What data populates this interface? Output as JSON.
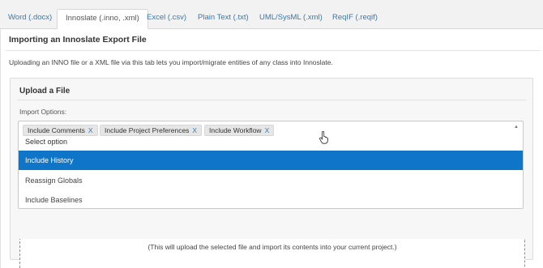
{
  "tabs": [
    {
      "label": "Word (.docx)",
      "active": false
    },
    {
      "label": "Innoslate (.inno, .xml)",
      "active": true
    },
    {
      "label": "Excel (.csv)",
      "active": false
    },
    {
      "label": "Plain Text (.txt)",
      "active": false
    },
    {
      "label": "UML/SysML (.xml)",
      "active": false
    },
    {
      "label": "ReqIF (.reqif)",
      "active": false
    }
  ],
  "section": {
    "title": "Importing an Innoslate Export File",
    "description": "Uploading an INNO file or a XML file via this tab lets you import/migrate entities of any class into Innoslate."
  },
  "upload": {
    "title": "Upload a File",
    "options_label": "Import Options:",
    "selected_options": [
      "Include Comments",
      "Include Project Preferences",
      "Include Workflow"
    ],
    "remove_glyph": "X",
    "select_placeholder": "Select option",
    "dropdown_items": [
      "Include History",
      "Reassign Globals",
      "Include Baselines"
    ],
    "highlighted_item": "Include History",
    "drop_note": "(This will upload the selected file and import its contents into your current project.)"
  },
  "colors": {
    "link": "#337ab7",
    "highlight": "#0e75c9"
  },
  "icons": {
    "caret": "caret-up-icon",
    "cursor": "hand-pointer-icon"
  }
}
